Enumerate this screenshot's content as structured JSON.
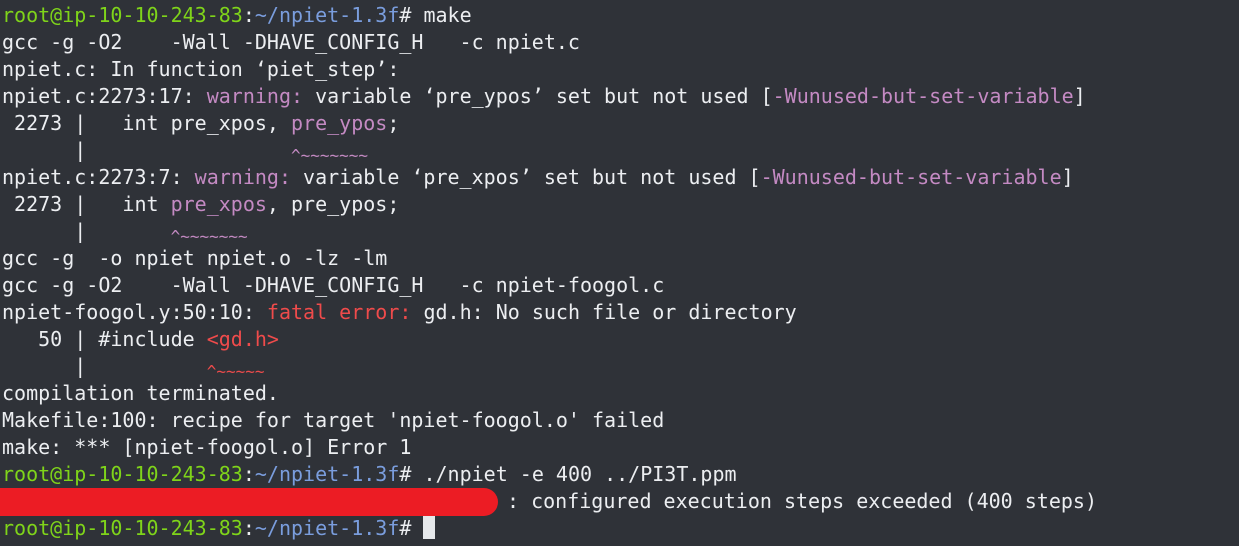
{
  "terminal": {
    "prompt_user_host": "root@ip-10-10-243-83",
    "prompt_colon": ":",
    "prompt_path": "~/npiet-1.3f",
    "prompt_symbol": "# ",
    "cmd_make": "make",
    "cmd_run": "./npiet -e 400 ../PI3T.ppm",
    "out_gcc1": "gcc -g -O2    -Wall -DHAVE_CONFIG_H   -c npiet.c",
    "out_infunc": "npiet.c: In function ‘piet_step’:",
    "w1_loc": "npiet.c:2273:17: ",
    "w1_label": "warning:",
    "w1_msg": " variable ‘pre_ypos’ set but not used [",
    "w1_flag": "-Wunused-but-set-variable",
    "w1_close": "]",
    "w1_src_pre": " 2273 |   int pre_xpos, ",
    "w1_src_hl": "pre_ypos",
    "w1_src_post": ";",
    "w1_caret_pre": "      |                 ",
    "w1_caret": "^~~~~~~~",
    "w2_loc": "npiet.c:2273:7: ",
    "w2_label": "warning:",
    "w2_msg": " variable ‘pre_xpos’ set but not used [",
    "w2_flag": "-Wunused-but-set-variable",
    "w2_close": "]",
    "w2_src_pre": " 2273 |   int ",
    "w2_src_hl": "pre_xpos",
    "w2_src_post": ", pre_ypos;",
    "w2_caret_pre": "      |       ",
    "w2_caret": "^~~~~~~~",
    "out_link": "gcc -g  -o npiet npiet.o -lz -lm",
    "out_gcc2": "gcc -g -O2    -Wall -DHAVE_CONFIG_H   -c npiet-foogol.c",
    "e_loc": "npiet-foogol.y:50:10: ",
    "e_label": "fatal error:",
    "e_msg": " gd.h: No such file or directory",
    "e_src_pre": "   50 | #include ",
    "e_src_hl": "<gd.h>",
    "e_caret_pre": "      |          ",
    "e_caret": "^~~~~~",
    "out_terminated": "compilation terminated.",
    "out_recipe": "Makefile:100: recipe for target 'npiet-foogol.o' failed",
    "out_make_err": "make: *** [npiet-foogol.o] Error 1",
    "out_steps": ": configured execution steps exceeded (400 steps)"
  },
  "colors": {
    "background": "#2f3238",
    "text": "#eceef1",
    "prompt_user": "#7fd41a",
    "prompt_path": "#7a9ddd",
    "warning": "#c48ac3",
    "error": "#ef4b4b",
    "redaction": "#ec1c24"
  }
}
